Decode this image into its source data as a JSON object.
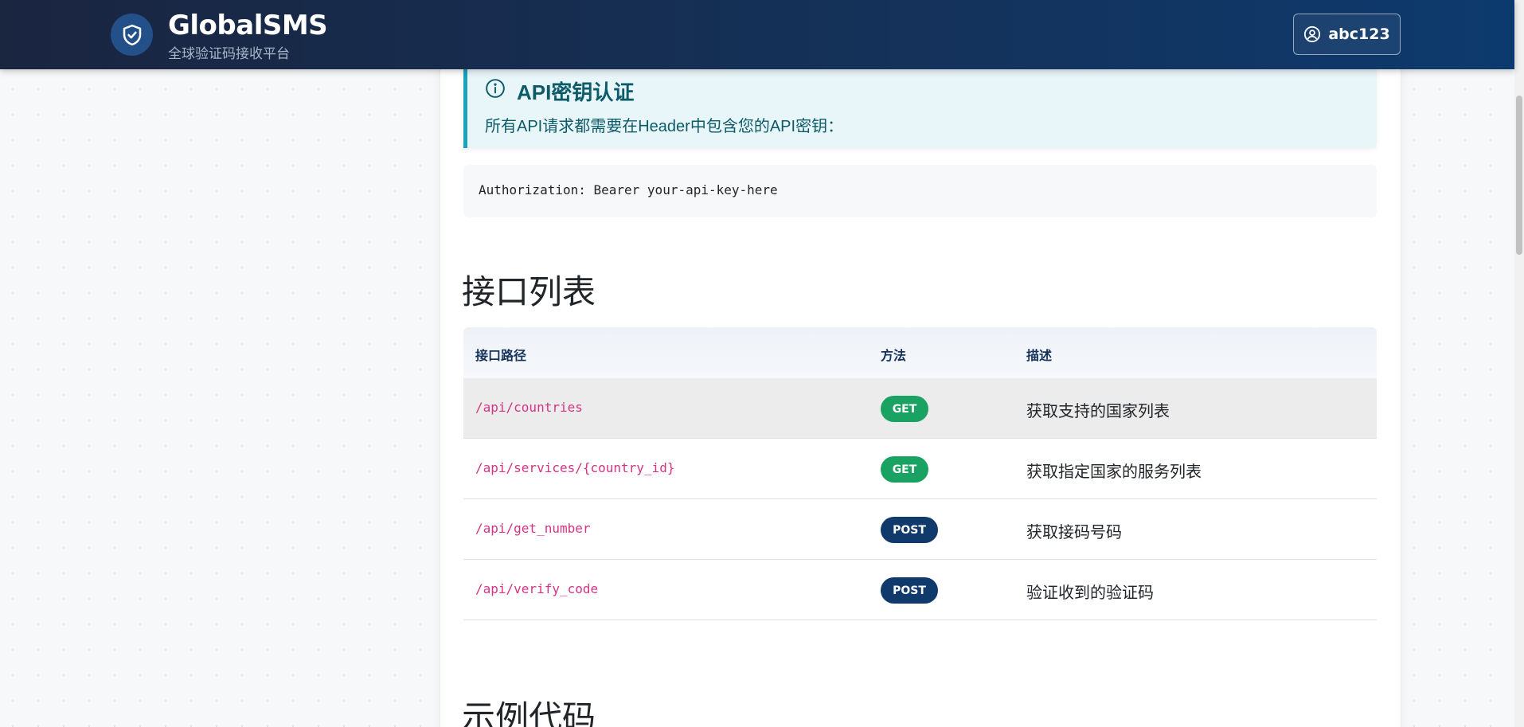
{
  "navbar": {
    "brand_title": "GlobalSMS",
    "brand_subtitle": "全球验证码接收平台",
    "brand_icon": "shield-check-icon",
    "user_label": "abc123",
    "user_icon": "user-circle-icon"
  },
  "auth_alert": {
    "icon": "info-circle-icon",
    "title": "API密钥认证",
    "text": "所有API请求都需要在Header中包含您的API密钥："
  },
  "auth_code": "Authorization: Bearer your-api-key-here",
  "endpoints_section": {
    "title": "接口列表",
    "headers": {
      "path": "接口路径",
      "method": "方法",
      "description": "描述"
    },
    "rows": [
      {
        "path": "/api/countries",
        "method": "GET",
        "description": "获取支持的国家列表"
      },
      {
        "path": "/api/services/{country_id}",
        "method": "GET",
        "description": "获取指定国家的服务列表"
      },
      {
        "path": "/api/get_number",
        "method": "POST",
        "description": "获取接码号码"
      },
      {
        "path": "/api/verify_code",
        "method": "POST",
        "description": "验证收到的验证码"
      }
    ]
  },
  "example_section": {
    "title": "示例代码"
  },
  "colors": {
    "get_badge": "#1aa262",
    "post_badge": "#0f3a6b",
    "path_text": "#d63384",
    "alert_accent": "#1aa3bc"
  }
}
